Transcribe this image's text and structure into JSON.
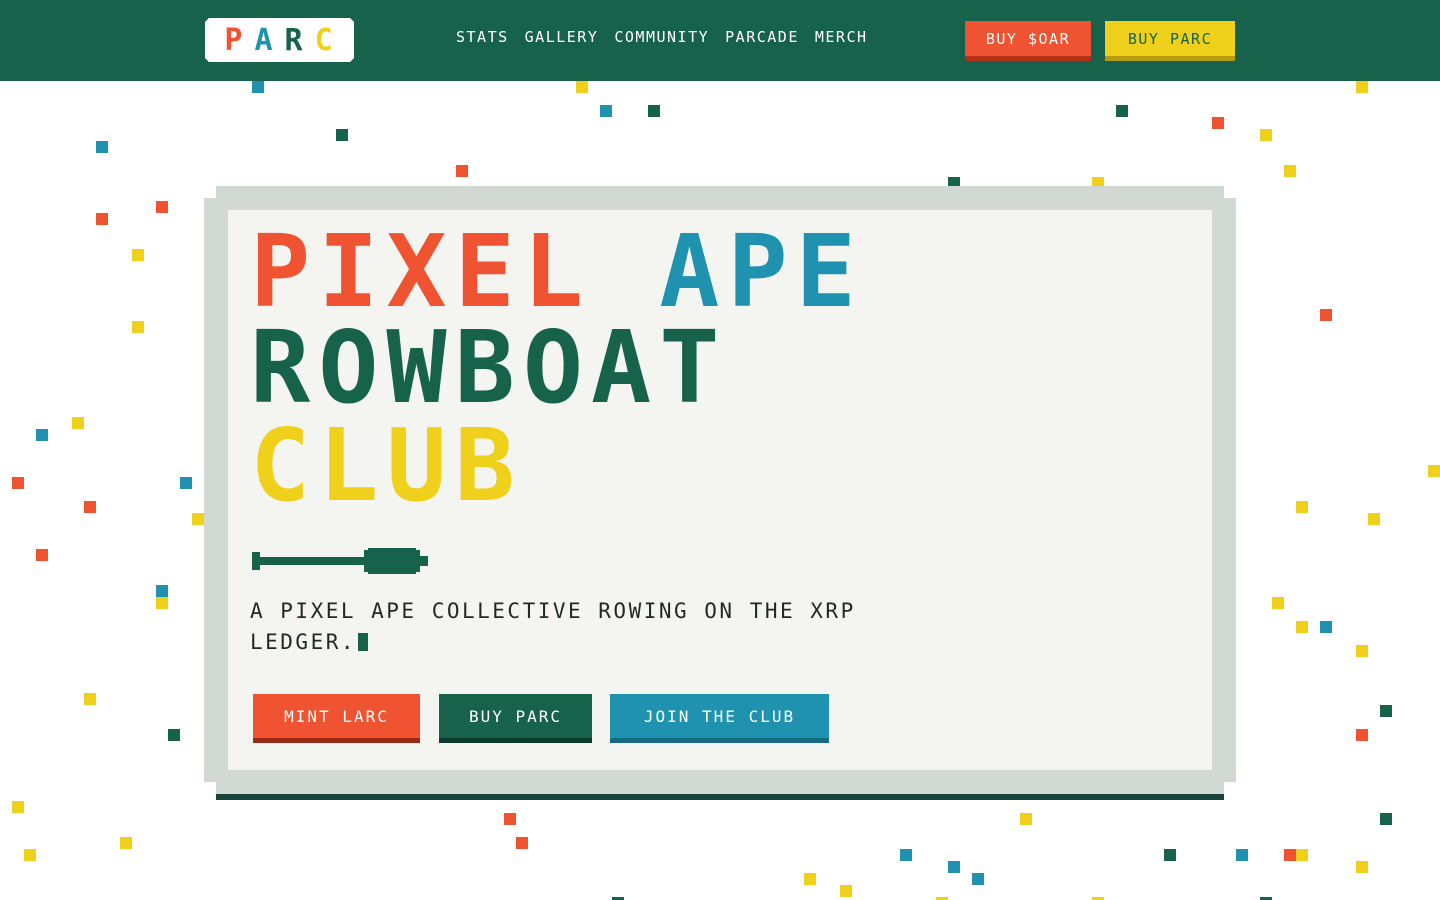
{
  "header": {
    "logo": [
      "P",
      "A",
      "R",
      "C"
    ],
    "logo_colors": [
      "#ef5331",
      "#1e92ae",
      "#17624a",
      "#efd01b"
    ],
    "nav": [
      "STATS",
      "GALLERY",
      "COMMUNITY",
      "PARCADE",
      "MERCH"
    ],
    "buy_oar": "BUY $OAR",
    "buy_parc": "BUY PARC"
  },
  "hero": {
    "title_line1_a": "PIXEL",
    "title_line1_b": "APE",
    "title_line2": "ROWBOAT",
    "title_line3": "CLUB",
    "tagline": "A PIXEL APE COLLECTIVE ROWING ON THE XRP LEDGER.",
    "buttons": {
      "mint": "MINT LARC",
      "buy": "BUY PARC",
      "join": "JOIN THE CLUB"
    }
  },
  "colors": {
    "brand_green": "#17624a",
    "orange": "#ef5331",
    "blue": "#1e92ae",
    "yellow": "#efd01b",
    "card_bg": "#f4f4f1",
    "card_border": "#d2d9d3"
  },
  "decor": {
    "oar_icon": "oar-icon",
    "confetti": "pixel-confetti"
  }
}
